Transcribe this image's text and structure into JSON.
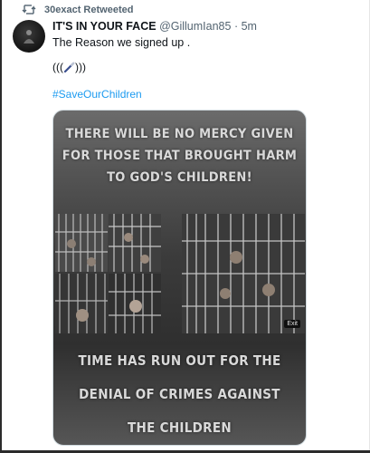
{
  "retweet": {
    "label": "30exact Retweeted",
    "icon": "retweet-icon"
  },
  "tweet": {
    "author_name": "IT'S IN YOUR FACE",
    "handle": "@GillumIan85",
    "separator": "·",
    "time": "5m",
    "text": "The Reason we signed up .",
    "emoji_line_open": "(((",
    "emoji_line_close": ")))",
    "emoji_icon": "paintbrush-icon",
    "hashtag": "#SaveOurChildren"
  },
  "media": {
    "headline_top": [
      "THERE WILL BE NO MERCY GIVEN",
      "FOR THOSE THAT BROUGHT HARM",
      "TO GOD'S CHILDREN!"
    ],
    "headline_bottom": [
      "TIME HAS RUN OUT FOR THE",
      "DENIAL OF CRIMES AGAINST",
      "THE CHILDREN"
    ],
    "badge": "Exit"
  },
  "colors": {
    "link": "#1d9bf0",
    "secondary_text": "#536471",
    "primary_text": "#0f1419"
  }
}
